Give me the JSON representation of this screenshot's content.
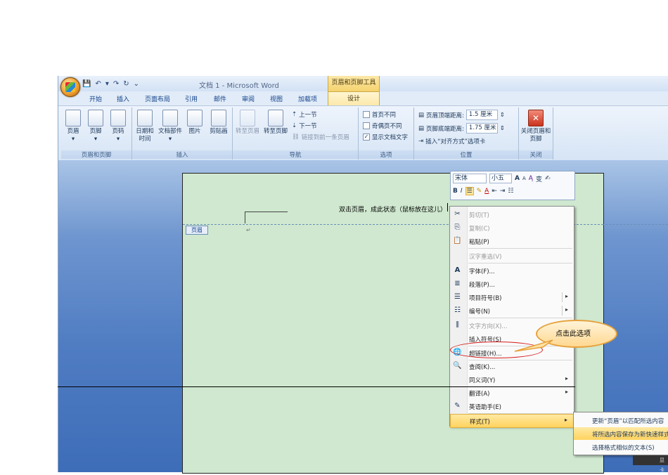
{
  "window": {
    "title": "文档 1 - Microsoft Word",
    "contextual_group": "页眉和页脚工具",
    "qat": [
      "💾",
      "↶",
      "▾",
      "↷",
      "↻",
      "⌄"
    ]
  },
  "tabs": [
    {
      "label": "开始"
    },
    {
      "label": "插入"
    },
    {
      "label": "页面布局"
    },
    {
      "label": "引用"
    },
    {
      "label": "邮件"
    },
    {
      "label": "审阅"
    },
    {
      "label": "视图"
    },
    {
      "label": "加载项"
    }
  ],
  "active_tab": "设计",
  "ribbon": {
    "group_header_footer": {
      "label": "页眉和页脚",
      "buttons": [
        {
          "label": "页眉"
        },
        {
          "label": "页脚"
        },
        {
          "label": "页码"
        }
      ]
    },
    "group_insert": {
      "label": "插入",
      "buttons": [
        {
          "label": "日期和时间"
        },
        {
          "label": "文档部件"
        },
        {
          "label": "图片"
        },
        {
          "label": "剪贴画"
        }
      ]
    },
    "group_navigation": {
      "label": "导航",
      "goto_header": "转至页眉",
      "goto_footer": "转至页脚",
      "prev_section": "上一节",
      "next_section": "下一节",
      "link_previous": "链接到前一条页眉"
    },
    "group_options": {
      "label": "选项",
      "first_page": "首页不同",
      "odd_even": "奇偶页不同",
      "show_text": "显示文档文字",
      "check": "✓"
    },
    "group_position": {
      "label": "位置",
      "header_top_label": "页眉顶端距离:",
      "header_top_value": "1.5 厘米",
      "footer_bottom_label": "页脚底端距离:",
      "footer_bottom_value": "1.75 厘米",
      "align_tab": "插入“对齐方式”选项卡"
    },
    "group_close": {
      "label": "关闭",
      "close_button": "关闭页眉和页脚"
    }
  },
  "document": {
    "header_note": "双击页眉，成此状态（鼠标放在这儿）",
    "header_tag": "页眉",
    "para_mark": "↵"
  },
  "mini_toolbar": {
    "font": "宋体",
    "size": "小五",
    "grow": "A",
    "shrink": "A",
    "bold": "B",
    "italic": "I"
  },
  "context_menu": [
    {
      "label": "剪切(T)",
      "disabled": true,
      "icon": "✂"
    },
    {
      "label": "复制(C)",
      "disabled": true,
      "icon": "⎘"
    },
    {
      "label": "粘贴(P)",
      "disabled": false,
      "icon": "📋"
    },
    {
      "label": "汉字重选(V)",
      "disabled": true,
      "icon": ""
    },
    {
      "label": "字体(F)...",
      "disabled": false,
      "icon": "A"
    },
    {
      "label": "段落(P)...",
      "disabled": false,
      "icon": "≣"
    },
    {
      "label": "项目符号(B)",
      "disabled": false,
      "icon": "☰",
      "submenu": true
    },
    {
      "label": "编号(N)",
      "disabled": false,
      "icon": "☷",
      "submenu": true
    },
    {
      "label": "文字方向(X)...",
      "disabled": true,
      "icon": "⫼"
    },
    {
      "label": "插入符号(S)",
      "disabled": false,
      "icon": ""
    },
    {
      "label": "超链接(H)...",
      "disabled": false,
      "icon": "🌐"
    },
    {
      "label": "查阅(K)...",
      "disabled": false,
      "icon": "🔍"
    },
    {
      "label": "同义词(Y)",
      "disabled": false,
      "icon": "",
      "submenu": true
    },
    {
      "label": "翻译(A)",
      "disabled": false,
      "icon": "",
      "submenu": true
    },
    {
      "label": "英语助手(E)",
      "disabled": false,
      "icon": "✎"
    },
    {
      "label": "样式(T)",
      "disabled": false,
      "icon": "",
      "submenu": true,
      "highlight": true
    }
  ],
  "callout": {
    "text": "点击此选项"
  },
  "submenu": [
    {
      "label": "更新“页眉”以匹配所选内容",
      "highlight": false
    },
    {
      "label": "将所选内容保存为新快速样式...",
      "highlight": true
    },
    {
      "label": "选择格式相似的文本(S)",
      "highlight": false
    }
  ],
  "status_chip": "显卡"
}
